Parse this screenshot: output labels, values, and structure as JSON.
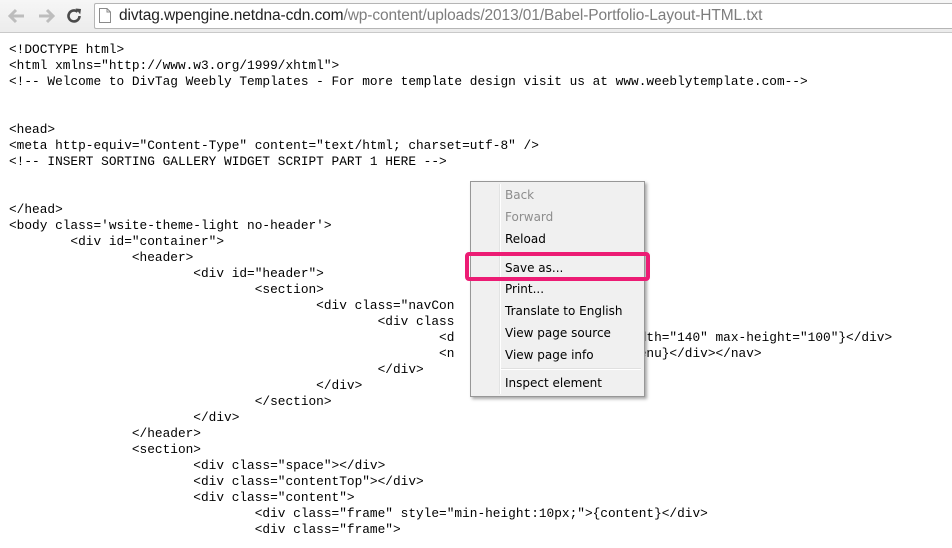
{
  "toolbar": {
    "back_icon": "back-arrow-icon",
    "forward_icon": "forward-arrow-icon",
    "reload_icon": "reload-icon",
    "url_host": "divtag.wpengine.netdna-cdn.com",
    "url_path": "/wp-content/uploads/2013/01/Babel-Portfolio-Layout-HTML.txt"
  },
  "source": {
    "lines": [
      "<!DOCTYPE html>",
      "<html xmlns=\"http://www.w3.org/1999/xhtml\">",
      "<!-- Welcome to DivTag Weebly Templates - For more template design visit us at www.weeblytemplate.com-->",
      "",
      "",
      "<head>",
      "<meta http-equiv=\"Content-Type\" content=\"text/html; charset=utf-8\" />",
      "<!-- INSERT SORTING GALLERY WIDGET SCRIPT PART 1 HERE -->",
      "",
      "",
      "</head>",
      "<body class='wsite-theme-light no-header'>",
      "        <div id=\"container\">",
      "                <header>",
      "                        <div id=\"header\">",
      "                                <section>",
      "                                        <div class=\"navCon",
      "                                                <div class",
      "                                                        <d                    x-width=\"140\" max-height=\"100\"}</div>",
      "                                                        <n                    \">{menu}</div></nav>",
      "                                                </div>",
      "                                        </div>",
      "                                </section>",
      "                        </div>",
      "                </header>",
      "                <section>",
      "                        <div class=\"space\"></div>",
      "                        <div class=\"contentTop\"></div>",
      "                        <div class=\"content\">",
      "                                <div class=\"frame\" style=\"min-height:10px;\">{content}</div>",
      "                                <div class=\"frame\">"
    ]
  },
  "context_menu": {
    "items": [
      {
        "label": "Back",
        "enabled": false
      },
      {
        "label": "Forward",
        "enabled": false
      },
      {
        "label": "Reload",
        "enabled": true
      },
      {
        "label": "Save as...",
        "enabled": true,
        "highlighted": true
      },
      {
        "label": "Print...",
        "enabled": true
      },
      {
        "label": "Translate to English",
        "enabled": true
      },
      {
        "label": "View page source",
        "enabled": true
      },
      {
        "label": "View page info",
        "enabled": true
      },
      {
        "label": "Inspect element",
        "enabled": true
      }
    ]
  },
  "colors": {
    "highlight_border": "#ec1c74",
    "menu_background": "#f0f0f0",
    "disabled_text": "#8d8d8d"
  }
}
